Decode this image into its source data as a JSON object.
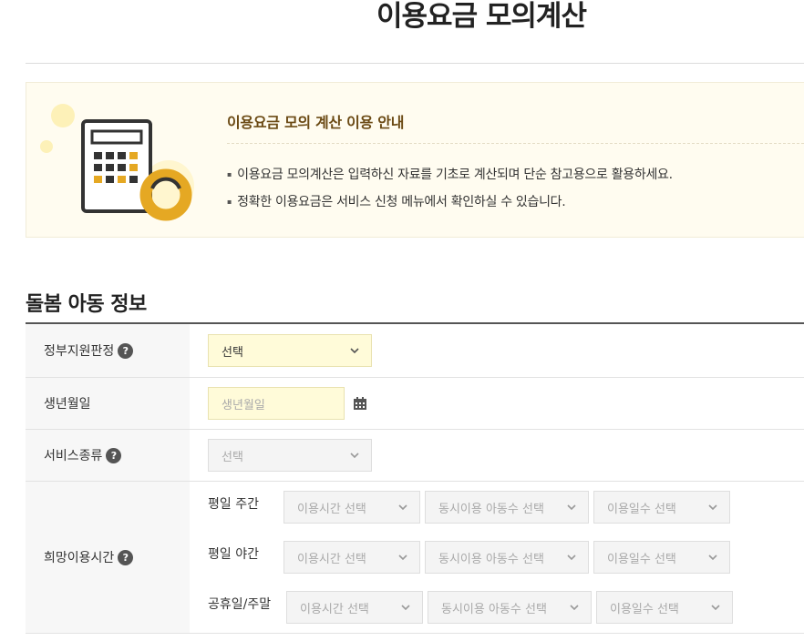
{
  "page": {
    "title": "이용요금 모의계산"
  },
  "notice": {
    "title": "이용요금 모의 계산 이용 안내",
    "items": [
      "이용요금 모의계산은 입력하신 자료를 기초로 계산되며 단순 참고용으로 활용하세요.",
      "정확한 이용요금은 서비스 신청 메뉴에서 확인하실 수 있습니다."
    ],
    "illustration": "calculator-icon"
  },
  "section": {
    "title": "돌봄 아동 정보"
  },
  "form": {
    "gov_support": {
      "label": "정부지원판정",
      "help": "?",
      "value": "선택"
    },
    "birth_date": {
      "label": "생년월일",
      "placeholder": "생년월일",
      "icon": "calendar-icon"
    },
    "service_type": {
      "label": "서비스종류",
      "help": "?",
      "value": "선택"
    },
    "hours": {
      "label": "희망이용시간",
      "help": "?",
      "rows": [
        {
          "label": "평일 주간",
          "time": "이용시간 선택",
          "children": "동시이용 아동수 선택",
          "days": "이용일수 선택"
        },
        {
          "label": "평일 야간",
          "time": "이용시간 선택",
          "children": "동시이용 아동수 선택",
          "days": "이용일수 선택"
        },
        {
          "label": "공휴일/주말",
          "time": "이용시간 선택",
          "children": "동시이용 아동수 선택",
          "days": "이용일수 선택"
        }
      ]
    }
  },
  "colors": {
    "accent": "#e5a823",
    "notice_bg": "#fffcf0",
    "input_active": "#fffbd9"
  }
}
